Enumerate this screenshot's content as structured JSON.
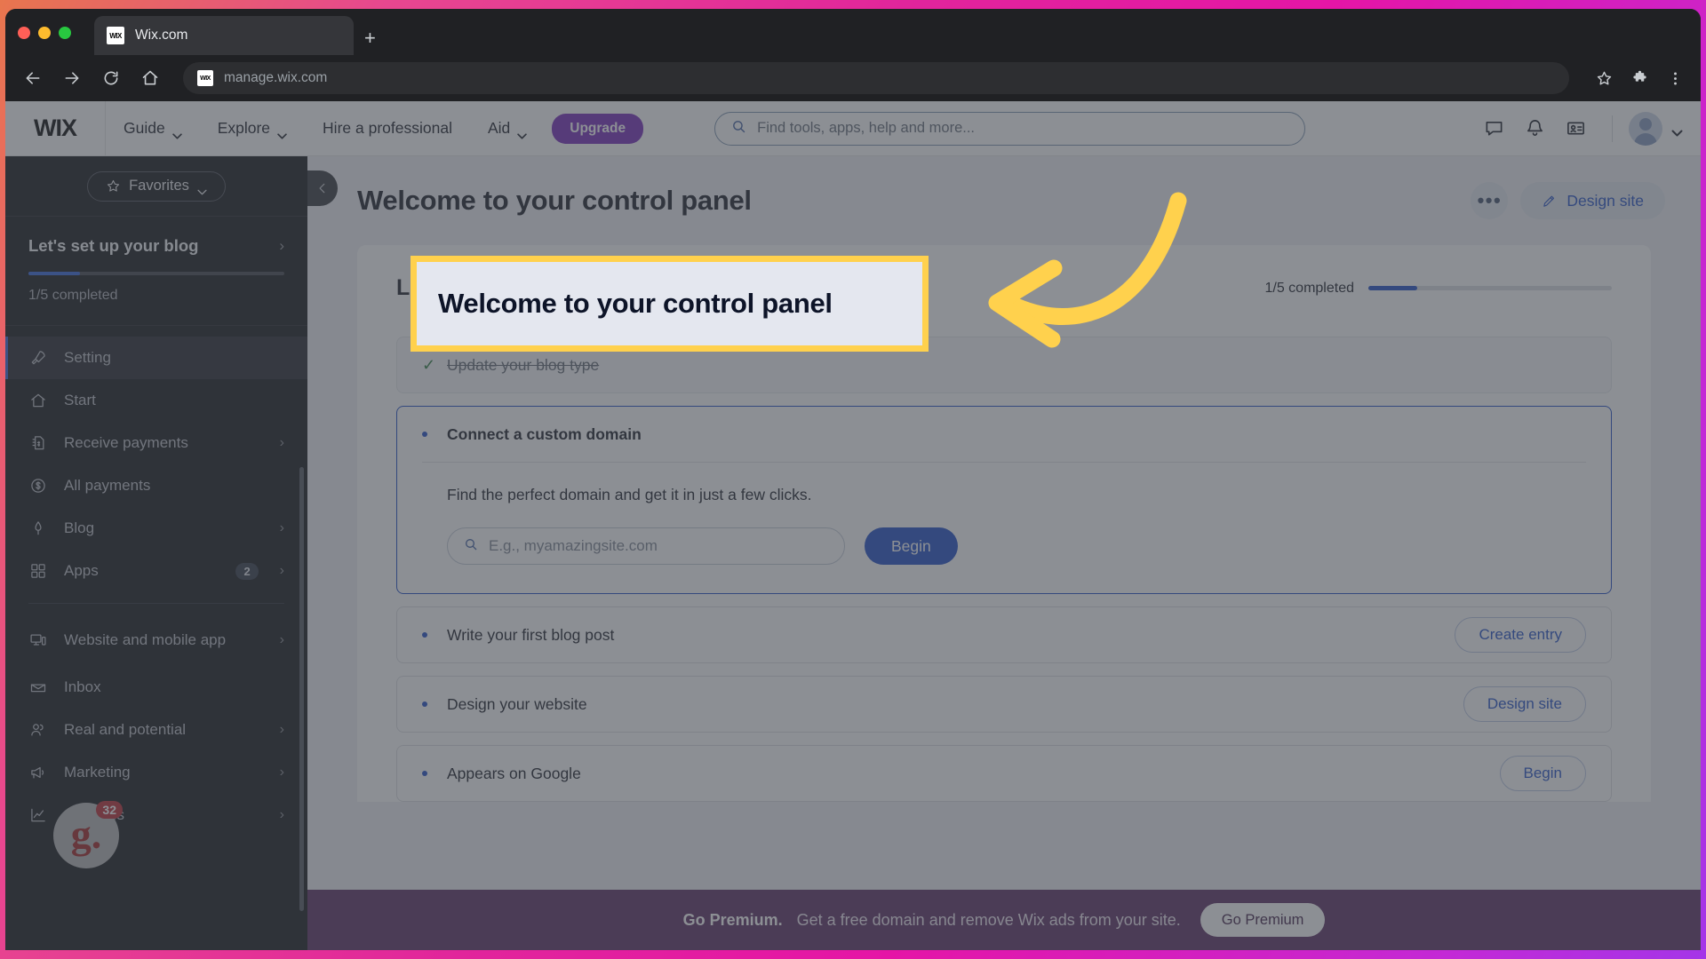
{
  "browser": {
    "tab_title": "Wix.com",
    "favicon_text": "WIX",
    "new_tab_label": "+",
    "url": "manage.wix.com",
    "url_favicon_text": "WIX"
  },
  "topnav": {
    "logo": "WIX",
    "items": [
      {
        "label": "Guide",
        "has_chevron": true
      },
      {
        "label": "Explore",
        "has_chevron": true
      },
      {
        "label": "Hire a professional",
        "has_chevron": false
      },
      {
        "label": "Aid",
        "has_chevron": true
      }
    ],
    "upgrade_label": "Upgrade",
    "search_placeholder": "Find tools, apps, help and more..."
  },
  "sidebar": {
    "favorites_label": "Favorites",
    "setup_title": "Let's set up your blog",
    "setup_progress_text": "1/5 completed",
    "setup_progress_percent": 20,
    "items": [
      {
        "label": "Setting",
        "icon": "rocket-icon",
        "arrow": "",
        "badge": "",
        "active": true
      },
      {
        "label": "Start",
        "icon": "home-icon",
        "arrow": "",
        "badge": "",
        "active": false
      },
      {
        "label": "Receive payments",
        "icon": "invoice-icon",
        "arrow": "›",
        "badge": "",
        "active": false
      },
      {
        "label": "All payments",
        "icon": "dollar-circle-icon",
        "arrow": "",
        "badge": "",
        "active": false
      },
      {
        "label": "Blog",
        "icon": "pen-icon",
        "arrow": "›",
        "badge": "",
        "active": false
      },
      {
        "label": "Apps",
        "icon": "apps-grid-icon",
        "arrow": "›",
        "badge": "2",
        "active": false
      }
    ],
    "items2": [
      {
        "label": "Website and mobile app",
        "icon": "devices-icon",
        "arrow": "›",
        "badge": ""
      },
      {
        "label": "Inbox",
        "icon": "inbox-icon",
        "arrow": "",
        "badge": ""
      },
      {
        "label": "Real and potential",
        "icon": "people-icon",
        "arrow": "›",
        "badge": ""
      },
      {
        "label": "Marketing",
        "icon": "megaphone-icon",
        "arrow": "›",
        "badge": ""
      },
      {
        "label": "Analytics",
        "icon": "chart-line-icon",
        "arrow": "›",
        "badge": ""
      }
    ],
    "widget": {
      "letter": "g.",
      "count": "32"
    }
  },
  "main": {
    "page_title": "Welcome to your control panel",
    "more_label": "•••",
    "design_site_label": "Design site",
    "card": {
      "title": "Let's set up your blog",
      "progress_text": "1/5 completed",
      "progress_percent": 20,
      "tasks": [
        {
          "label": "Update your blog type",
          "state": "done",
          "button": "",
          "sub": "",
          "input_placeholder": "",
          "input_button": ""
        },
        {
          "label": "Connect a custom domain",
          "state": "open",
          "button": "",
          "sub": "Find the perfect domain and get it in just a few clicks.",
          "input_placeholder": "E.g., myamazingsite.com",
          "input_button": "Begin"
        },
        {
          "label": "Write your first blog post",
          "state": "todo",
          "button": "Create entry",
          "sub": "",
          "input_placeholder": "",
          "input_button": ""
        },
        {
          "label": "Design your website",
          "state": "todo",
          "button": "Design site",
          "sub": "",
          "input_placeholder": "",
          "input_button": ""
        },
        {
          "label": "Appears on Google",
          "state": "todo",
          "button": "Begin",
          "sub": "",
          "input_placeholder": "",
          "input_button": ""
        }
      ]
    }
  },
  "premium": {
    "bold": "Go Premium.",
    "text": "Get a free domain and remove Wix ads from your site.",
    "button": "Go Premium"
  },
  "annotation": {
    "highlight_text": "Welcome to your control panel",
    "highlight_color": "#ffd14d",
    "arrow_color": "#ffd14d"
  }
}
